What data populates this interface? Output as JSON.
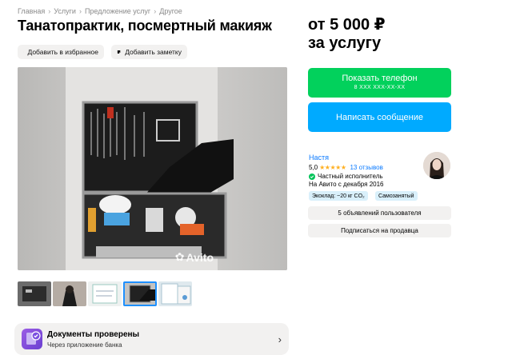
{
  "breadcrumb": [
    "Главная",
    "Услуги",
    "Предложение услуг",
    "Другое"
  ],
  "title": "Танатопрактик, посмертный макияж",
  "actions": {
    "favorite": "Добавить в избранное",
    "note": "Добавить заметку"
  },
  "photo": {
    "watermark": "Avito"
  },
  "documents": {
    "title": "Документы проверены",
    "subtitle": "Через приложение банка"
  },
  "price": {
    "amount": "от 5 000 ₽",
    "unit": "за услугу"
  },
  "buttons": {
    "phone": "Показать телефон",
    "phone_number": "8 XXX XXX-XX-XX",
    "message": "Написать сообщение"
  },
  "seller": {
    "name": "Настя",
    "rating": "5,0",
    "stars": "★★★★★",
    "reviews": "13 отзывов",
    "type": "Частный исполнитель",
    "since": "На Авито с декабря 2016",
    "badges": {
      "eco": "Экоклад: ~20 кг CO₂",
      "self": "Самозанятый"
    },
    "ads": "5 объявлений пользователя",
    "subscribe": "Подписаться на продавца"
  },
  "colors": {
    "green": "#02d15c",
    "blue": "#00aaff",
    "link": "#0a7aff",
    "star": "#ffb021"
  }
}
